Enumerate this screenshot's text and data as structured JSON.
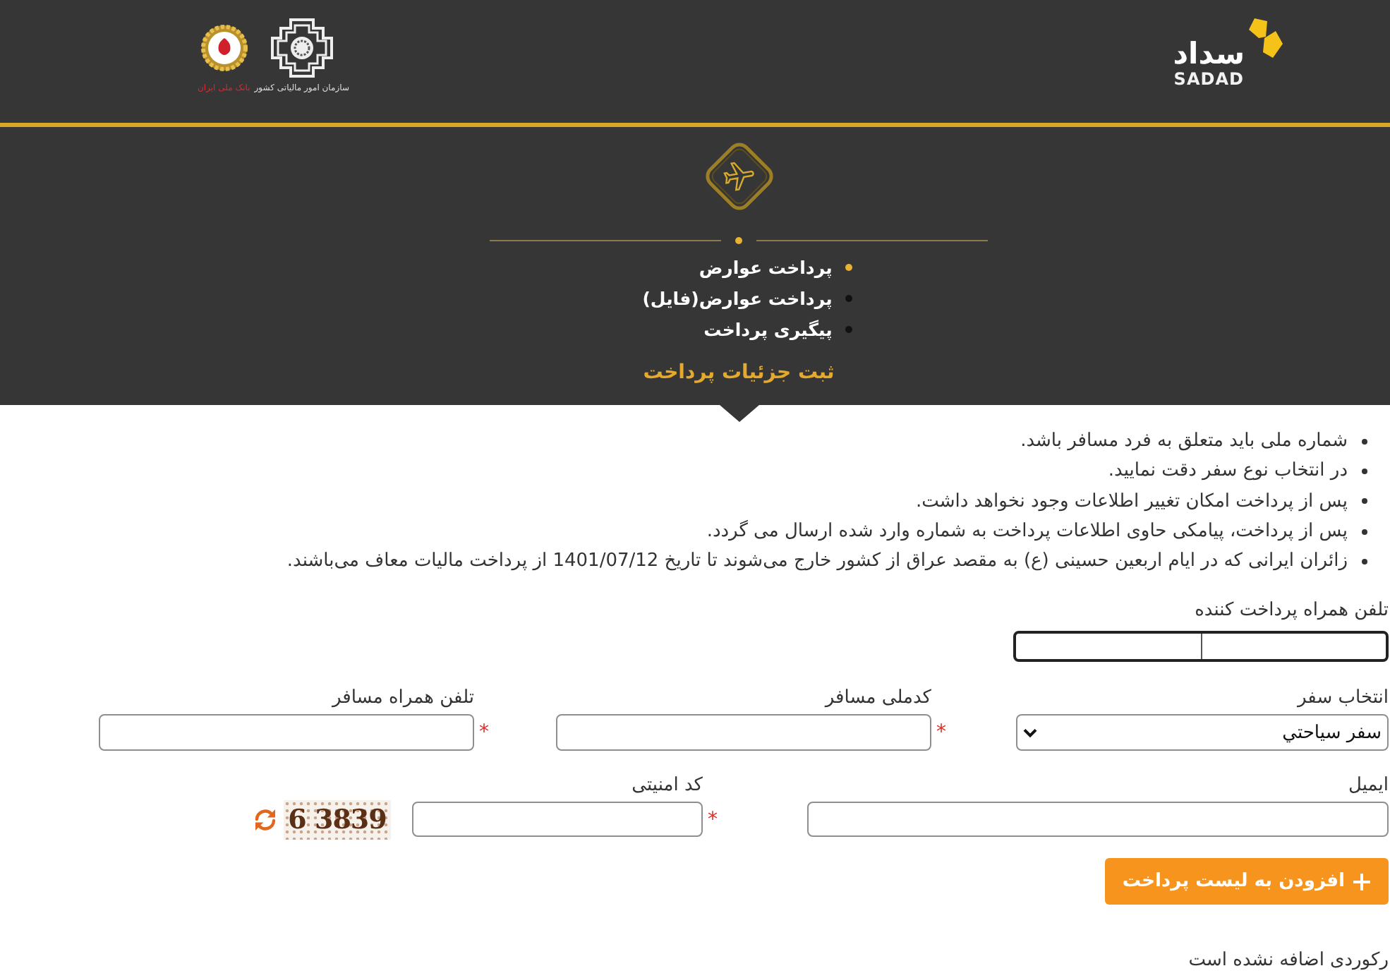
{
  "header": {
    "sadad_logo": {
      "script_text": "سداد",
      "latin_text": "SADAD"
    },
    "bank_logo": {
      "caption": "بانک ملی ایران"
    },
    "tax_logo": {
      "caption": "سازمان امور مالیاتی کشور"
    }
  },
  "hero": {
    "menu": [
      {
        "label": "پرداخت عوارض",
        "selected": true
      },
      {
        "label": "پرداخت عوارض(فایل)",
        "selected": false
      },
      {
        "label": "پیگیری پرداخت",
        "selected": false
      }
    ],
    "section_title": "ثبت جزئیات پرداخت"
  },
  "notes": [
    "شماره ملی باید متعلق به فرد مسافر باشد.",
    "در انتخاب نوع سفر دقت نمایید.",
    "پس از پرداخت امکان تغییر اطلاعات وجود نخواهد داشت.",
    "پس از پرداخت، پیامکی حاوی اطلاعات پرداخت به شماره وارد شده ارسال می گردد.",
    "زائران ایرانی که در ایام اربعین حسینی (ع) به مقصد عراق از کشور خارج می‌شوند تا تاریخ 1401/07/12 از پرداخت مالیات معاف می‌باشند."
  ],
  "form": {
    "payer_phone": {
      "label": "تلفن همراه پرداخت کننده"
    },
    "rows": [
      {
        "fields": [
          {
            "kind": "select",
            "label": "انتخاب سفر",
            "value": "سفر سياحتي"
          },
          {
            "kind": "text",
            "label": "کدملی مسافر",
            "required_mark": "*"
          },
          {
            "kind": "text",
            "label": "تلفن همراه مسافر",
            "required_mark": "*"
          }
        ]
      },
      {
        "fields": [
          {
            "kind": "text",
            "label": "ایمیل"
          },
          {
            "kind": "text",
            "label": "کد امنیتی",
            "required_mark": "*"
          },
          {
            "kind": "captcha",
            "text": "6 3839"
          }
        ]
      }
    ]
  },
  "add_button": {
    "label": "افزودن به لیست پرداخت"
  },
  "empty_message": "رکوردی اضافه نشده است"
}
